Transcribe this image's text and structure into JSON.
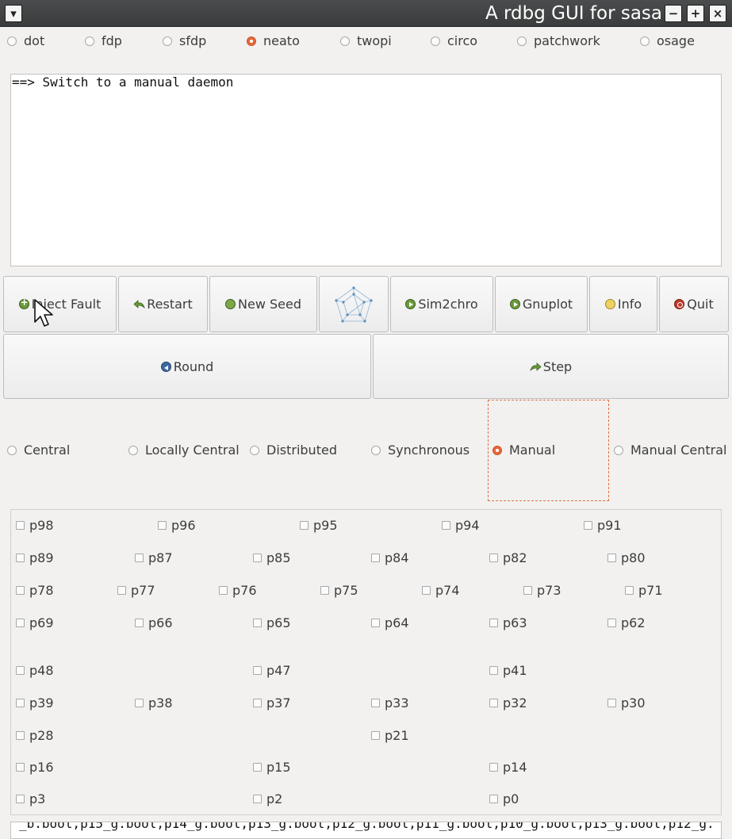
{
  "window": {
    "title": "A rdbg GUI for sasa",
    "menu_glyph": "▾",
    "minimize_glyph": "−",
    "maximize_glyph": "+",
    "close_glyph": "×"
  },
  "layouts": {
    "selected": "neato",
    "options": [
      "dot",
      "fdp",
      "sfdp",
      "neato",
      "twopi",
      "circo",
      "patchwork",
      "osage"
    ]
  },
  "console": {
    "text": "==> Switch to a manual daemon"
  },
  "toolbar": {
    "inject_fault": "Inject Fault",
    "restart": "Restart",
    "new_seed": "New Seed",
    "graph_icon": "graph-icon",
    "sim2chro": "Sim2chro",
    "gnuplot": "Gnuplot",
    "info": "Info",
    "quit": "Quit"
  },
  "stepping": {
    "round": "Round",
    "step": "Step"
  },
  "daemons": {
    "selected": "Manual",
    "options": [
      "Central",
      "Locally Central",
      "Distributed",
      "Synchronous",
      "Manual",
      "Manual Central"
    ]
  },
  "processes": {
    "rows": [
      [
        "p98",
        "p96",
        "p95",
        "p94",
        "p91"
      ],
      [
        "p89",
        "p87",
        "p85",
        "p84",
        "p82",
        "p80"
      ],
      [
        "p78",
        "p77",
        "p76",
        "p75",
        "p74",
        "p73",
        "p71"
      ],
      [
        "p69",
        "p66",
        "p65",
        "p64",
        "p63",
        "p62"
      ],
      [
        "p48",
        "p47",
        "p41"
      ],
      [
        "p39",
        "p38",
        "p37",
        "p33",
        "p32",
        "p30"
      ],
      [
        "p28",
        "p21"
      ],
      [
        "p16",
        "p15",
        "p14"
      ],
      [
        "p3",
        "p2",
        "p0"
      ]
    ]
  },
  "bottom_text": "_b.bool,p15_g.bool,p14_g.bool,p13_g.bool,p12_g.bool,p11_g.bool,p10_g.bool,p13_g.bool,p12_g."
}
